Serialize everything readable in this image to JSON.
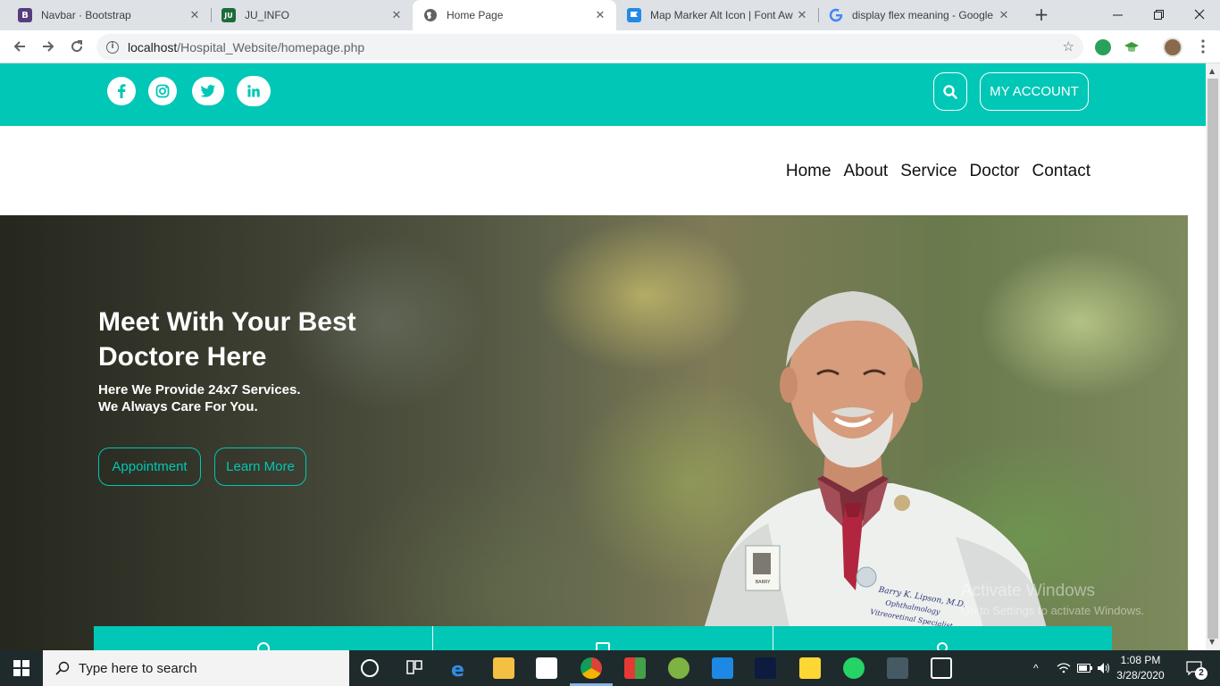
{
  "browser": {
    "tabs": [
      {
        "title": "Navbar · Bootstrap",
        "favicon": "B",
        "favicon_color": "#563d7c"
      },
      {
        "title": "JU_INFO",
        "favicon": "JU",
        "favicon_color": "#1e6b3a"
      },
      {
        "title": "Home Page",
        "favicon": "globe",
        "favicon_color": "#5f6368"
      },
      {
        "title": "Map Marker Alt Icon | Font Aw",
        "favicon": "flag",
        "favicon_color": "#228ae6"
      },
      {
        "title": "display flex meaning - Google",
        "favicon": "G",
        "favicon_color": "#4285f4"
      }
    ],
    "close_glyph": "✕",
    "new_tab_glyph": "+",
    "url_host": "localhost",
    "url_path": "/Hospital_Website/homepage.php"
  },
  "site": {
    "accent": "#00c7b6",
    "social": [
      "f",
      "ig",
      "tw",
      "in"
    ],
    "account_label": "MY ACCOUNT",
    "menu": [
      "Home",
      "About",
      "Service",
      "Doctor",
      "Contact"
    ],
    "hero": {
      "title": "Meet With Your Best Doctore Here",
      "subtitle_line1": "Here We Provide 24x7 Services.",
      "subtitle_line2": "We Always Care For You.",
      "btn_appointment": "Appointment",
      "btn_learn": "Learn More",
      "coat_text": [
        "Barry K. Lipson, M.D.",
        "Ophthalmology",
        "Vitreoretinal Specialist"
      ],
      "badge_text": "BARRY"
    },
    "watermark_line1": "Activate Windows",
    "watermark_line2": "Go to Settings to activate Windows."
  },
  "taskbar": {
    "search_placeholder": "Type here to search",
    "time": "1:08 PM",
    "date": "3/28/2020",
    "notifications": "2"
  }
}
